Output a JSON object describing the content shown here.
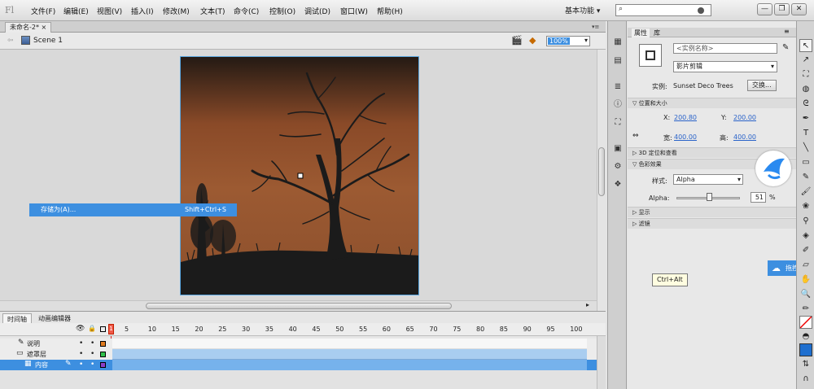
{
  "app": {
    "logo": "Fl"
  },
  "menu": [
    "文件(F)",
    "编辑(E)",
    "视图(V)",
    "插入(I)",
    "修改(M)",
    "文本(T)",
    "命令(C)",
    "控制(O)",
    "调试(D)",
    "窗口(W)",
    "帮助(H)"
  ],
  "workspace": {
    "label": "基本功能"
  },
  "search": {
    "placeholder": ""
  },
  "window_buttons": [
    "—",
    "❐",
    "✕"
  ],
  "document": {
    "tab": "未命名-2*",
    "close": "×",
    "scene": "Scene 1",
    "zoom": "100%"
  },
  "context_menu": {
    "label": "存储为(A)...",
    "shortcut": "Shift+Ctrl+S"
  },
  "tooltip": {
    "text": "Ctrl+Alt"
  },
  "floating_badge": {
    "text": "拖拽上"
  },
  "timeline": {
    "tabs": [
      "时间轴",
      "动画编辑器"
    ],
    "frame_numbers": [
      "5",
      "10",
      "15",
      "20",
      "25",
      "30",
      "35",
      "40",
      "45",
      "50",
      "55",
      "60",
      "65",
      "70",
      "75",
      "80",
      "85",
      "90",
      "95",
      "100"
    ],
    "current_frame": "1",
    "layers": [
      {
        "name": "说明",
        "color": "#e07b1f"
      },
      {
        "name": "遮罩层",
        "color": "#2fbf4a"
      },
      {
        "name": "内容",
        "color": "#8a3fc8"
      }
    ]
  },
  "properties": {
    "tabs": [
      "属性",
      "库"
    ],
    "instance_name_placeholder": "<实例名称>",
    "symbol_type": "影片剪辑",
    "instance_label": "实例:",
    "instance_value": "Sunset Deco Trees",
    "swap_button": "交换...",
    "sections": {
      "position": "位置和大小",
      "threed": "3D 定位和查看",
      "color_effect": "色彩效果",
      "display": "显示",
      "filters": "滤镜"
    },
    "x_label": "X:",
    "x_value": "200.80",
    "y_label": "Y:",
    "y_value": "200.00",
    "w_label": "宽:",
    "w_value": "400.00",
    "h_label": "高:",
    "h_value": "400.00",
    "style_label": "样式:",
    "style_value": "Alpha",
    "alpha_label": "Alpha:",
    "alpha_value": "51",
    "alpha_unit": "%"
  },
  "colors": {
    "accent": "#3d8fe0",
    "stage_top": "#2b1e16",
    "stage_mid": "#9a5630",
    "ground": "#1b1b1b"
  }
}
